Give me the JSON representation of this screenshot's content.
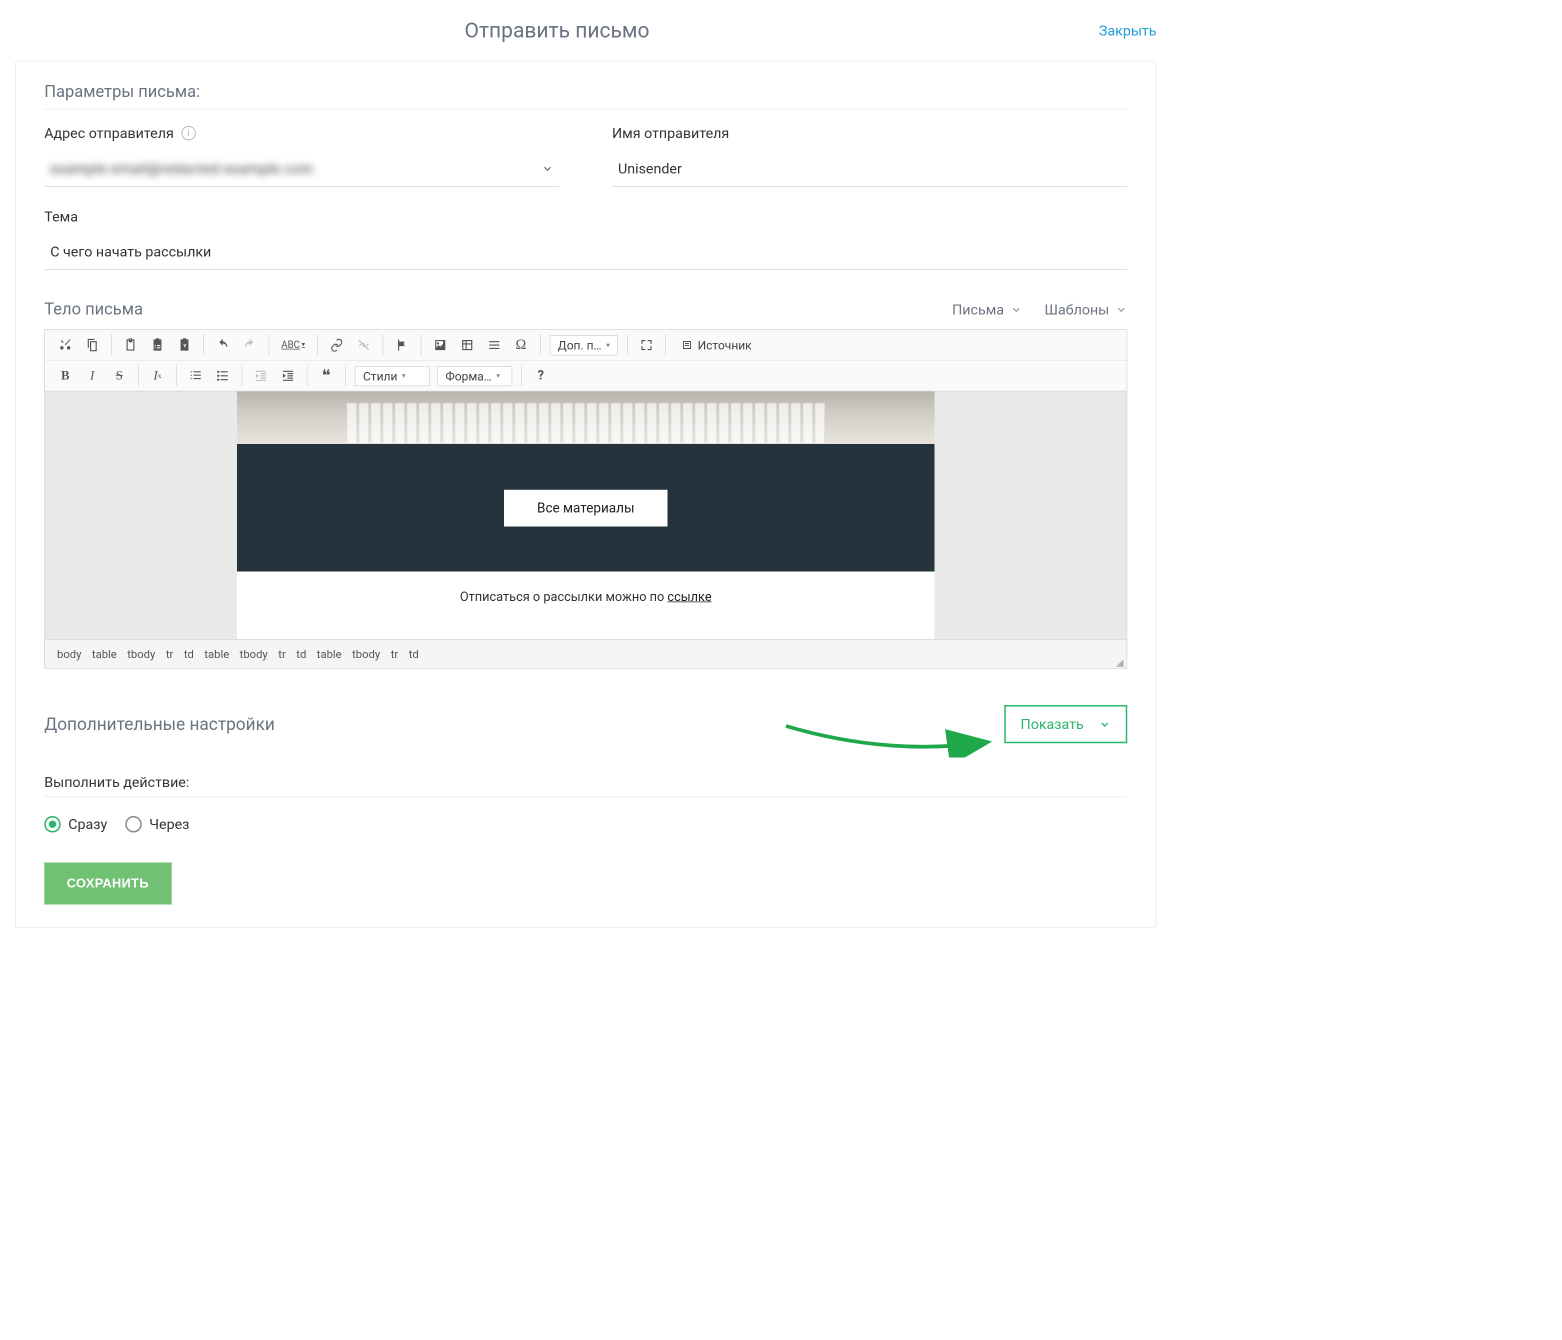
{
  "header": {
    "title": "Отправить письмо",
    "close": "Закрыть"
  },
  "params": {
    "section_title": "Параметры письма:",
    "sender_addr_label": "Адрес отправителя",
    "sender_addr_value": "example.email@redacted.example.com",
    "sender_name_label": "Имя отправителя",
    "sender_name_value": "Unisender",
    "subject_label": "Тема",
    "subject_value": "С чего начать рассылки"
  },
  "body": {
    "label": "Тело письма",
    "dropdown_letters": "Письма",
    "dropdown_templates": "Шаблоны",
    "cta_button": "Все материалы",
    "unsubscribe_text": "Отписаться о рассылки можно по ",
    "unsubscribe_link": "ссылке"
  },
  "toolbar": {
    "more": "Доп. п…",
    "source": "Источник",
    "styles": "Стили",
    "format": "Форма…"
  },
  "pathbar": [
    "body",
    "table",
    "tbody",
    "tr",
    "td",
    "table",
    "tbody",
    "tr",
    "td",
    "table",
    "tbody",
    "tr",
    "td"
  ],
  "extra": {
    "title": "Дополнительные настройки",
    "show": "Показать",
    "action_label": "Выполнить действие:",
    "radio_now": "Сразу",
    "radio_after": "Через",
    "save": "СОХРАНИТЬ"
  }
}
